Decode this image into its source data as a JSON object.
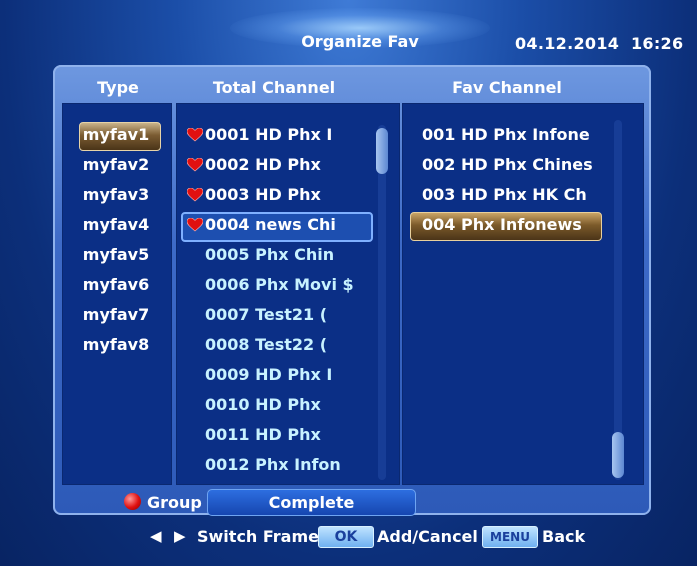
{
  "header": {
    "title": "Organize Fav",
    "date": "04.12.2014",
    "time": "16:26"
  },
  "columns": {
    "type": "Type",
    "total": "Total Channel",
    "fav": "Fav Channel"
  },
  "type_list": [
    "myfav1",
    "myfav2",
    "myfav3",
    "myfav4",
    "myfav5",
    "myfav6",
    "myfav7",
    "myfav8"
  ],
  "total_list": [
    {
      "label": "0001 HD Phx I",
      "fav": true
    },
    {
      "label": "0002 HD Phx",
      "fav": true
    },
    {
      "label": "0003 HD Phx",
      "fav": true
    },
    {
      "label": "0004 news Chi",
      "fav": true
    },
    {
      "label": "0005 Phx Chin",
      "fav": false
    },
    {
      "label": "0006 Phx Movi $",
      "fav": false
    },
    {
      "label": "0007 Test21 (",
      "fav": false
    },
    {
      "label": "0008 Test22 (",
      "fav": false
    },
    {
      "label": "0009 HD Phx I",
      "fav": false
    },
    {
      "label": "0010 HD Phx",
      "fav": false
    },
    {
      "label": "0011 HD Phx",
      "fav": false
    },
    {
      "label": "0012 Phx Infon",
      "fav": false
    }
  ],
  "fav_list": [
    "001 HD Phx Infone",
    "002 HD Phx Chines",
    "003 HD Phx HK Ch",
    "004 Phx Infonews"
  ],
  "status_bar": {
    "group_label": "Group",
    "mode": "Complete"
  },
  "footer": {
    "switch_frame": "Switch Frame",
    "ok_key": "OK",
    "add_cancel": "Add/Cancel",
    "menu_key": "MENU",
    "back": "Back"
  },
  "colors": {
    "background": "#0c2f7a",
    "panel": "#3d6ac7",
    "list_bg": "#0b2f86",
    "selection_gold": "#7b5a2a",
    "heart": "#e01010"
  }
}
